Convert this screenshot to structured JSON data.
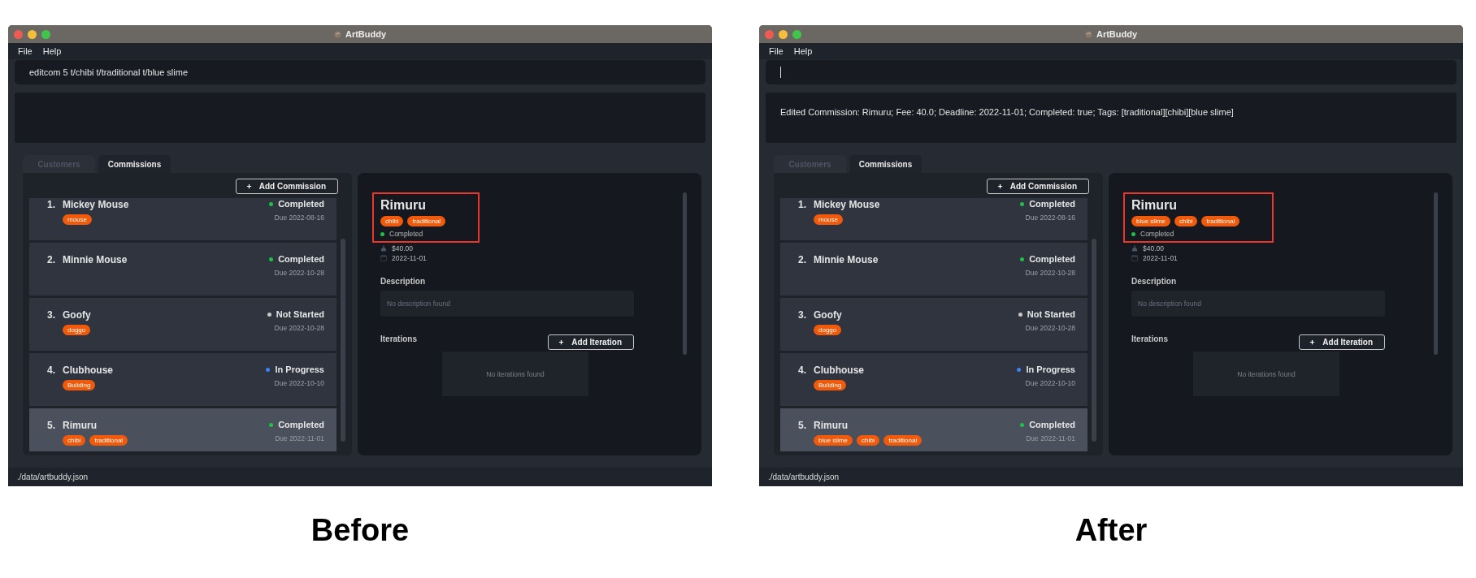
{
  "screens": [
    {
      "window": {
        "title": "ArtBuddy"
      },
      "menu": [
        "File",
        "Help"
      ],
      "command_box": {
        "value": "editcom 5 t/chibi t/traditional t/blue slime",
        "focused": false
      },
      "tabs": [
        {
          "label": "Customers",
          "selected": false
        },
        {
          "label": "Commissions",
          "selected": true
        }
      ],
      "add_button": "Add Commission",
      "commissions": [
        {
          "index": "1.",
          "title": "Mickey Mouse",
          "tags": [
            "mouse"
          ],
          "status": "Completed",
          "color": "#1fbf4a",
          "due": "Due 2022-08-16",
          "selected": false
        },
        {
          "index": "2.",
          "title": "Minnie Mouse",
          "status": "Completed",
          "color": "#1fbf4a",
          "due": "Due 2022-10-28",
          "selected": false
        },
        {
          "index": "3.",
          "title": "Goofy",
          "tags": [
            "doggo"
          ],
          "status": "Not Started",
          "color": "#c8c8c8",
          "due": "Due 2022-10-28",
          "selected": false
        },
        {
          "index": "4.",
          "title": "Clubhouse",
          "tags": [
            "Building"
          ],
          "status": "In Progress",
          "color": "#3b82f6",
          "due": "Due 2022-10-10",
          "selected": false
        },
        {
          "index": "5.",
          "title": "Rimuru",
          "tags": [
            "chibi",
            "traditional"
          ],
          "status": "Completed",
          "color": "#1fbf4a",
          "due": "Due 2022-11-01",
          "selected": true
        }
      ],
      "detail": {
        "highlighted": true,
        "title": "Rimuru",
        "tags": [
          "chibi",
          "traditional"
        ],
        "status": "Completed",
        "color": "#1fbf4a",
        "fee": "$40.00",
        "deadline": "2022-11-01",
        "description_label": "Description",
        "description": "No description found",
        "iterations_label": "Iterations",
        "add_iteration": "Add Iteration",
        "iterations": "No iterations found"
      },
      "status_bar": "./data/artbuddy.json",
      "caption": "Before"
    },
    {
      "window": {
        "title": "ArtBuddy"
      },
      "menu": [
        "File",
        "Help"
      ],
      "command_box": {
        "focused": true
      },
      "result": "Edited Commission: Rimuru; Fee: 40.0; Deadline: 2022-11-01; Completed: true; Tags: [traditional][chibi][blue slime]",
      "tabs": [
        {
          "label": "Customers",
          "selected": false
        },
        {
          "label": "Commissions",
          "selected": true
        }
      ],
      "add_button": "Add Commission",
      "commissions": [
        {
          "index": "1.",
          "title": "Mickey Mouse",
          "tags": [
            "mouse"
          ],
          "status": "Completed",
          "color": "#1fbf4a",
          "due": "Due 2022-08-16",
          "selected": false
        },
        {
          "index": "2.",
          "title": "Minnie Mouse",
          "status": "Completed",
          "color": "#1fbf4a",
          "due": "Due 2022-10-28",
          "selected": false
        },
        {
          "index": "3.",
          "title": "Goofy",
          "tags": [
            "doggo"
          ],
          "status": "Not Started",
          "color": "#c8c8c8",
          "due": "Due 2022-10-28",
          "selected": false
        },
        {
          "index": "4.",
          "title": "Clubhouse",
          "tags": [
            "Building"
          ],
          "status": "In Progress",
          "color": "#3b82f6",
          "due": "Due 2022-10-10",
          "selected": false
        },
        {
          "index": "5.",
          "title": "Rimuru",
          "tags": [
            "blue slime",
            "chibi",
            "traditional"
          ],
          "status": "Completed",
          "color": "#1fbf4a",
          "due": "Due 2022-11-01",
          "selected": true
        }
      ],
      "detail": {
        "highlighted": true,
        "title": "Rimuru",
        "tags": [
          "blue slime",
          "chibi",
          "traditional"
        ],
        "status": "Completed",
        "color": "#1fbf4a",
        "fee": "$40.00",
        "deadline": "2022-11-01",
        "description_label": "Description",
        "description": "No description found",
        "iterations_label": "Iterations",
        "add_iteration": "Add Iteration",
        "iterations": "No iterations found"
      },
      "status_bar": "./data/artbuddy.json",
      "caption": "After"
    }
  ]
}
